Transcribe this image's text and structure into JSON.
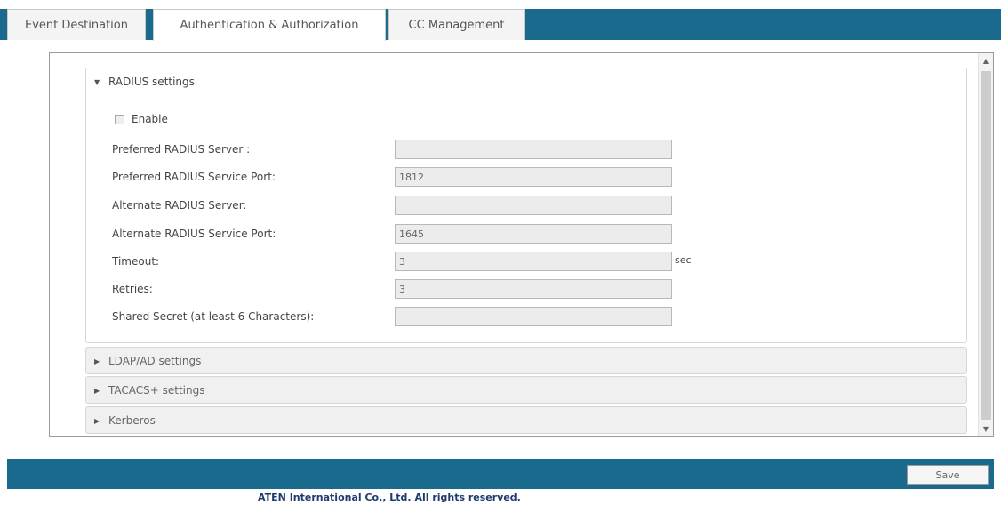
{
  "tabs": [
    {
      "label": "Event Destination",
      "active": false
    },
    {
      "label": "Authentication & Authorization",
      "active": true
    },
    {
      "label": "CC Management",
      "active": false
    }
  ],
  "radius": {
    "title": "RADIUS settings",
    "enable_label": "Enable",
    "enabled": false,
    "fields": [
      {
        "label": "Preferred RADIUS Server :",
        "value": ""
      },
      {
        "label": "Preferred RADIUS Service Port:",
        "value": "1812"
      },
      {
        "label": "Alternate RADIUS Server:",
        "value": ""
      },
      {
        "label": "Alternate RADIUS Service Port:",
        "value": "1645"
      },
      {
        "label": "Timeout:",
        "value": "3",
        "unit": "sec"
      },
      {
        "label": "Retries:",
        "value": "3"
      },
      {
        "label": "Shared Secret (at least 6 Characters):",
        "value": ""
      }
    ]
  },
  "collapsed_sections": [
    {
      "title": "LDAP/AD settings"
    },
    {
      "title": "TACACS+ settings"
    },
    {
      "title": "Kerberos"
    }
  ],
  "footer": {
    "save_label": "Save",
    "copyright": "ATEN International Co., Ltd. All rights reserved."
  },
  "colors": {
    "accent": "#1a6a8e",
    "copyright_text": "#1f3a6e"
  },
  "icons": {
    "expanded": "triangle-down-icon",
    "collapsed": "triangle-right-icon"
  }
}
